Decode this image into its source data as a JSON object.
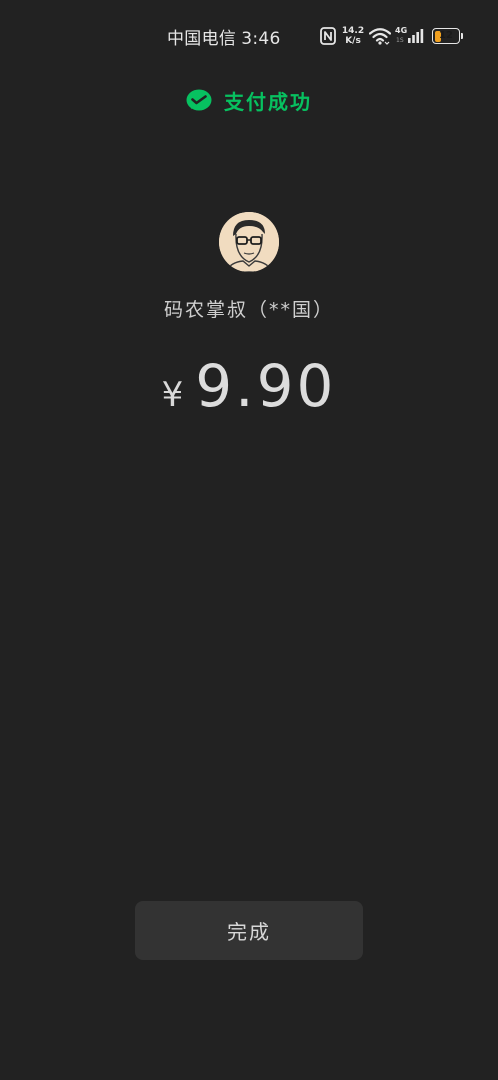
{
  "status_bar": {
    "carrier": "中国电信",
    "time": "3:46",
    "net_speed_value": "14.2",
    "net_speed_unit": "K/s",
    "network_type": "4G",
    "sim_slot": "1S",
    "battery_level": "12",
    "battery_fraction": 0.12,
    "battery_color": "#f0a020",
    "icons": [
      "nfc-icon",
      "wifi-icon",
      "signal-icon",
      "battery-icon"
    ]
  },
  "result": {
    "status_text": "支付成功",
    "status_icon": "wechat-pay-check-icon",
    "accent_color": "#07c160"
  },
  "payee": {
    "name": "码农掌叔（**国）"
  },
  "payment": {
    "currency_symbol": "¥",
    "amount": "9.90"
  },
  "actions": {
    "done_label": "完成"
  }
}
